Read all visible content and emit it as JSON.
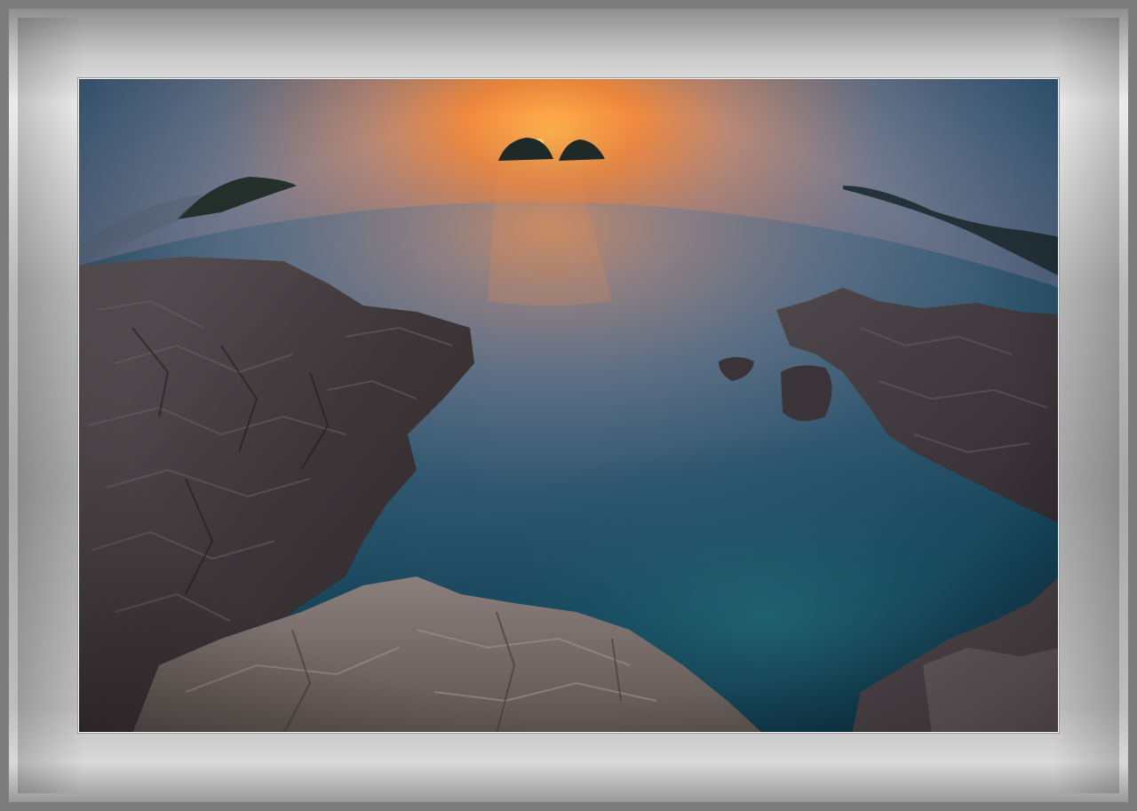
{
  "image": {
    "subject": "fisheye-seascape-sunset",
    "colors": {
      "frame": "#b4b4b4",
      "sky_top": "#2f5d86",
      "sun_glow": "#f08a3c",
      "sea_deep": "#123a4f",
      "rock": "#4a4448"
    }
  }
}
